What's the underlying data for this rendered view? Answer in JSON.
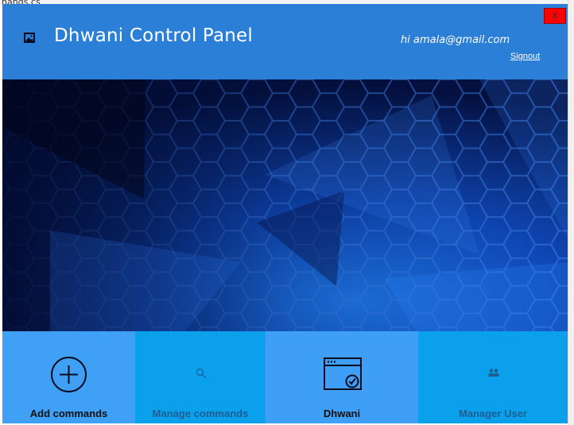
{
  "background": {
    "file_tab_text": "hands.cs"
  },
  "header": {
    "title": "Dhwani Control Panel",
    "greeting": "hi amala@gmail.com",
    "signout_label": "Signout",
    "close_label": "X",
    "icon": "image-icon"
  },
  "colors": {
    "header_bg": "#2b7fd6",
    "close_button": "#ff0000",
    "tile_blue": "#3fa0f5",
    "tile_cyan": "#0aa0ec"
  },
  "tiles": [
    {
      "label": "Add commands",
      "icon": "add-circle-icon"
    },
    {
      "label": "Manage commands",
      "icon": "search-icon"
    },
    {
      "label": "Dhwani",
      "icon": "app-window-check-icon"
    },
    {
      "label": "Manager User",
      "icon": "users-icon"
    }
  ]
}
